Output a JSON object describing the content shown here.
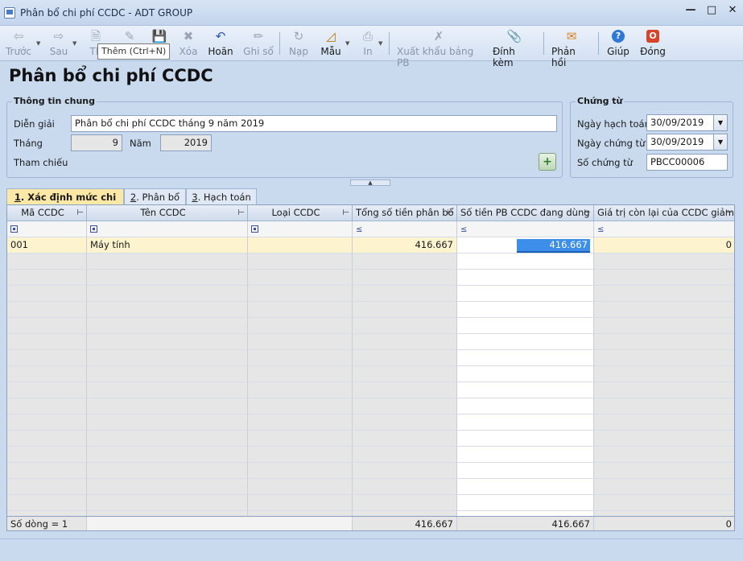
{
  "window": {
    "title": "Phân bổ chi phí CCDC - ADT GROUP"
  },
  "toolbar": {
    "prev": "Trước",
    "next": "Sau",
    "add_short": "Th",
    "delete": "Xóa",
    "undo": "Hoãn",
    "post": "Ghi sổ",
    "load": "Nạp",
    "template": "Mẫu",
    "print": "In",
    "export": "Xuất khẩu bảng PB",
    "attach": "Đính kèm",
    "feedback": "Phản hồi",
    "help": "Giúp",
    "close": "Đóng",
    "tooltip": "Thêm (Ctrl+N)"
  },
  "page": {
    "title": "Phân bổ chi phí CCDC"
  },
  "general": {
    "group_label": "Thông tin chung",
    "desc_label": "Diễn giải",
    "desc_value": "Phân bổ chi phí CCDC tháng 9 năm 2019",
    "month_label": "Tháng",
    "month_value": "9",
    "year_label": "Năm",
    "year_value": "2019",
    "ref_label": "Tham chiếu"
  },
  "voucher": {
    "group_label": "Chứng từ",
    "posting_date_label": "Ngày hạch toán",
    "posting_date": "30/09/2019",
    "voucher_date_label": "Ngày chứng từ",
    "voucher_date": "30/09/2019",
    "voucher_no_label": "Số chứng từ",
    "voucher_no": "PBCC00006"
  },
  "tabs": [
    {
      "num": "1",
      "label": ". Xác định mức chi phí"
    },
    {
      "num": "2",
      "label": ". Phân bổ"
    },
    {
      "num": "3",
      "label": ". Hạch toán"
    }
  ],
  "grid": {
    "columns": [
      "Mã CCDC",
      "Tên CCDC",
      "Loại CCDC",
      "Tổng số tiền phân bổ",
      "Số tiền PB CCDC đang dùng",
      "Giá trị còn lại của CCDC giảm"
    ],
    "filter_symbol": "≤",
    "rows": [
      {
        "code": "001",
        "name": "Máy tính",
        "type": "",
        "total": "416.667",
        "in_use": "416.667",
        "remaining": "0"
      }
    ],
    "footer": {
      "count": "Số dòng = 1",
      "total": "416.667",
      "in_use": "416.667",
      "remaining": "0"
    }
  }
}
